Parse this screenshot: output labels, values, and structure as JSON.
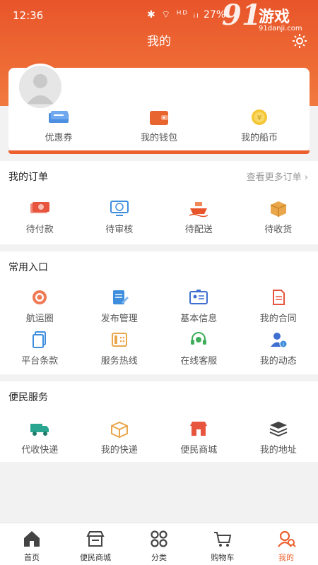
{
  "status_bar": {
    "time": "12:36",
    "icons": "✱ ⌔ ᴴᴰ ᵢₗ",
    "battery": "27%"
  },
  "watermark": {
    "number": "91",
    "text": "游戏",
    "url": "91danji.com"
  },
  "header": {
    "title": "我的"
  },
  "wallet": [
    {
      "label": "优惠券",
      "icon": "coupon-icon"
    },
    {
      "label": "我的钱包",
      "icon": "wallet-icon"
    },
    {
      "label": "我的船币",
      "icon": "coin-icon"
    }
  ],
  "orders": {
    "title": "我的订单",
    "more": "查看更多订单 ›",
    "items": [
      {
        "label": "待付款",
        "icon": "money-icon"
      },
      {
        "label": "待审核",
        "icon": "monitor-icon"
      },
      {
        "label": "待配送",
        "icon": "ship-icon"
      },
      {
        "label": "待收货",
        "icon": "box-icon"
      }
    ]
  },
  "common": {
    "title": "常用入口",
    "rows": [
      [
        {
          "label": "航运圈",
          "icon": "circle-icon"
        },
        {
          "label": "发布管理",
          "icon": "edit-doc-icon"
        },
        {
          "label": "基本信息",
          "icon": "id-card-icon"
        },
        {
          "label": "我的合同",
          "icon": "contract-icon"
        }
      ],
      [
        {
          "label": "平台条款",
          "icon": "terms-icon"
        },
        {
          "label": "服务热线",
          "icon": "phone-icon"
        },
        {
          "label": "在线客服",
          "icon": "headset-icon"
        },
        {
          "label": "我的动态",
          "icon": "user-info-icon"
        }
      ]
    ]
  },
  "services": {
    "title": "便民服务",
    "items": [
      {
        "label": "代收快递",
        "icon": "truck-icon"
      },
      {
        "label": "我的快递",
        "icon": "parcel-icon"
      },
      {
        "label": "便民商城",
        "icon": "shop-icon"
      },
      {
        "label": "我的地址",
        "icon": "layers-icon"
      }
    ]
  },
  "tabbar": [
    {
      "label": "首页",
      "icon": "home-icon",
      "active": false
    },
    {
      "label": "便民商城",
      "icon": "store-icon",
      "active": false
    },
    {
      "label": "分类",
      "icon": "grid-icon",
      "active": false
    },
    {
      "label": "购物车",
      "icon": "cart-icon",
      "active": false
    },
    {
      "label": "我的",
      "icon": "profile-icon",
      "active": true
    }
  ],
  "colors": {
    "brand": "#ec5f2d",
    "header_top": "#e8552a"
  }
}
